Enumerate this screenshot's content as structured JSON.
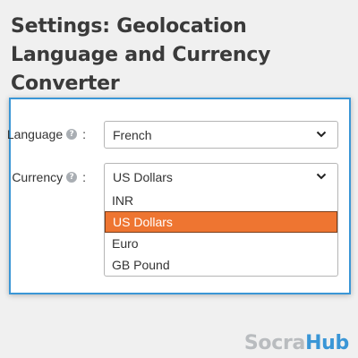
{
  "page": {
    "title": "Settings: Geolocation Language and Currency Converter"
  },
  "form": {
    "language": {
      "label": "Language",
      "help_icon": "?",
      "colon": ":",
      "value": "French"
    },
    "currency": {
      "label": "Currency",
      "help_icon": "?",
      "colon": ":",
      "value": "US Dollars",
      "options": [
        "INR",
        "US Dollars",
        "Euro",
        "GB Pound"
      ],
      "highlighted_option": "US Dollars"
    }
  },
  "brand": {
    "part1": "Socra",
    "part2": "Hub"
  },
  "colors": {
    "accent": "#3a96d6",
    "highlight": "#ee7531"
  }
}
